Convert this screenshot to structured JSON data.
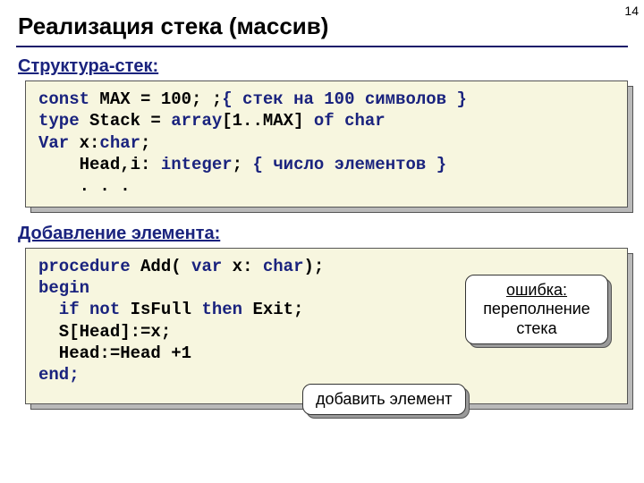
{
  "page_number": "14",
  "title": "Реализация стека (массив)",
  "sections": {
    "struct": {
      "label": "Структура-стек:",
      "code": {
        "l1a": "const",
        "l1b": " MAX = 100; ;",
        "l1c": "{ стек на 100 символов }",
        "l2a": "type",
        "l2b": " Stack = ",
        "l2c": "array",
        "l2d": "[1..MAX] ",
        "l2e": "of char",
        "l3a": "Var ",
        "l3b": "x:",
        "l3c": "char",
        "l3d": ";",
        "l4a": "    Head,i: ",
        "l4b": "integer",
        "l4c": "; ",
        "l4d": "{ число элементов }",
        "l5": "    . . ."
      }
    },
    "add": {
      "label": "Добавление элемента:",
      "code": {
        "l1a": "procedure",
        "l1b": " Add( ",
        "l1c": "var",
        "l1d": " x: ",
        "l1e": "char",
        "l1f": ");",
        "l2": "begin",
        "l3a": "  if not",
        "l3b": " IsFull ",
        "l3c": "then",
        "l3d": " Exit;",
        "l4": "  S[Head]:=x;",
        "l5": "  Head:=Head +1",
        "l6": "end;"
      }
    }
  },
  "callouts": {
    "error": {
      "line1": "ошибка:",
      "line2": "переполнение",
      "line3": "стека"
    },
    "add": "добавить элемент"
  }
}
